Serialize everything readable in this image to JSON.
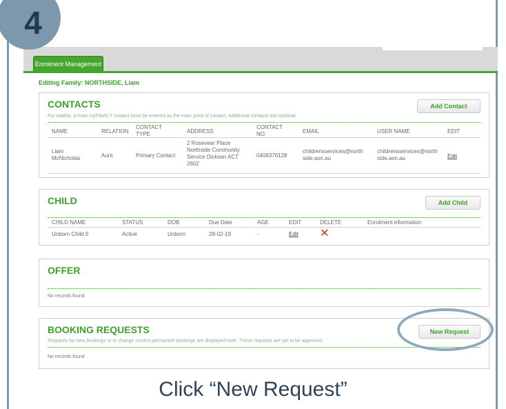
{
  "step_number": "4",
  "app": {
    "tab_label": "Enrolment Management"
  },
  "editing_family": "Editing Family: NORTHSIDE, Liam",
  "contacts": {
    "title": "CONTACTS",
    "add_label": "Add Contact",
    "note": "For waitlist, a main myFAMILY contact must be entered as the main point of contact. Additional contacts are optional.",
    "columns": [
      "NAME",
      "RELATION",
      "CONTACT TYPE",
      "ADDRESS",
      "CONTACT NO.",
      "EMAIL",
      "USER NAME",
      "EDIT"
    ],
    "row": {
      "name": "Liam McNicholas",
      "relation": "Aunt",
      "contact_type": "Primary Contact",
      "address": "2 Rosevear Place Northside Community Service Dickson ACT 2602",
      "contact_no": "0406376128",
      "email": "childrensservices@northside.asn.au",
      "user_name": "childrensservices@northside.asn.au",
      "edit": "Edit"
    }
  },
  "child": {
    "title": "CHILD",
    "add_label": "Add Child",
    "columns": [
      "CHILD NAME",
      "STATUS",
      "DOB",
      "Due Date",
      "AGE",
      "EDIT",
      "DELETE",
      "Enrolment information"
    ],
    "row": {
      "name": "Unborn Child 0",
      "status": "Active",
      "dob": "Unborn",
      "due_date": "28-02-19",
      "age": "-",
      "edit": "Edit"
    }
  },
  "offer": {
    "title": "OFFER",
    "empty": "No records found"
  },
  "booking": {
    "title": "BOOKING REQUESTS",
    "new_label": "New Request",
    "note": "Requests for new bookings or to change current permanent bookings are displayed here. These requests are yet to be approved.",
    "empty": "No records found"
  },
  "caption": "Click “New Request”",
  "colors": {
    "accent_green": "#44a62c",
    "frame_blue": "#7d98ad",
    "delete_red": "#e02a1c"
  },
  "icons": {
    "delete": "close-x-icon"
  }
}
